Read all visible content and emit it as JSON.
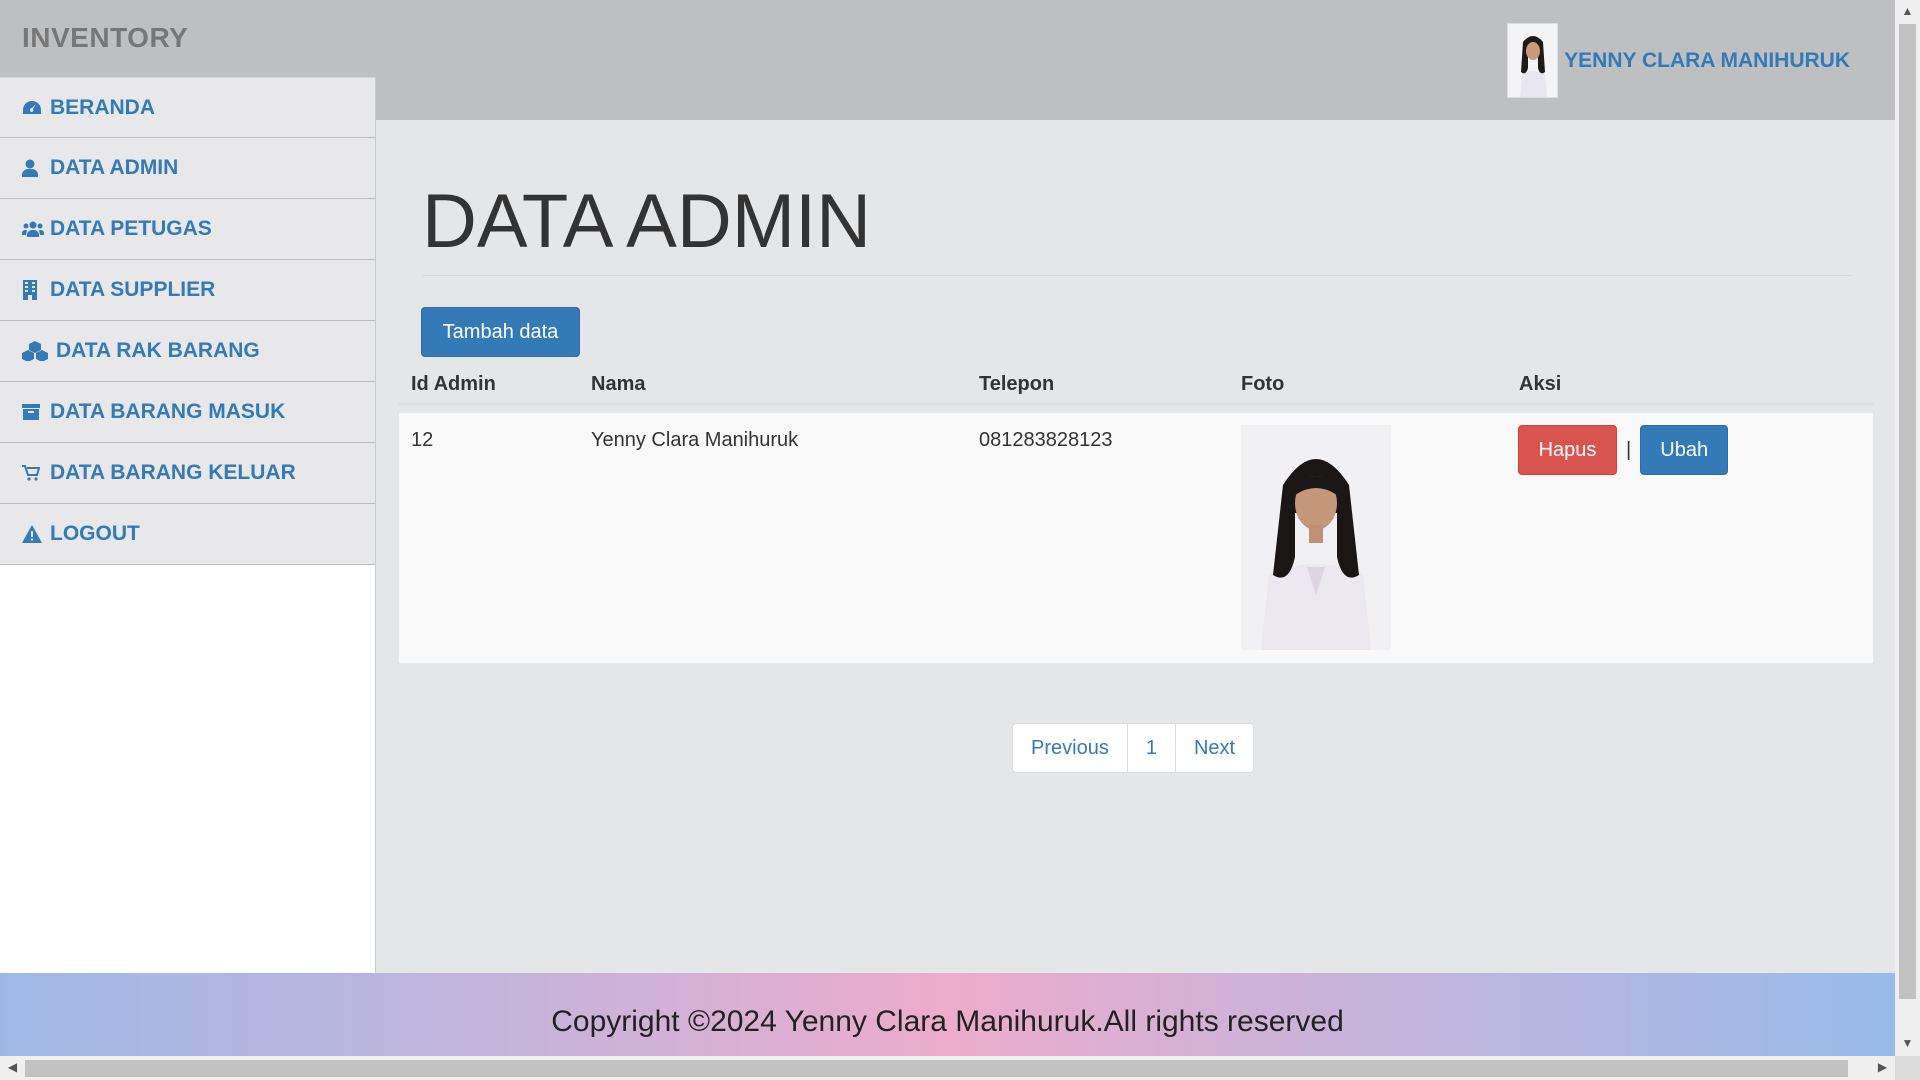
{
  "app": {
    "brand": "INVENTORY"
  },
  "user": {
    "name": "YENNY CLARA MANIHURUK"
  },
  "sidebar": {
    "items": [
      {
        "label": "BERANDA",
        "icon": "dashboard-icon"
      },
      {
        "label": "DATA ADMIN",
        "icon": "user-icon"
      },
      {
        "label": "DATA PETUGAS",
        "icon": "users-icon"
      },
      {
        "label": "DATA SUPPLIER",
        "icon": "building-icon"
      },
      {
        "label": "DATA RAK BARANG",
        "icon": "cubes-icon"
      },
      {
        "label": "DATA BARANG MASUK",
        "icon": "archive-icon"
      },
      {
        "label": "DATA BARANG KELUAR",
        "icon": "cart-icon"
      },
      {
        "label": "LOGOUT",
        "icon": "warning-icon"
      }
    ]
  },
  "main": {
    "title": "DATA ADMIN",
    "add_button": "Tambah data",
    "table": {
      "headers": [
        "Id Admin",
        "Nama",
        "Telepon",
        "Foto",
        "Aksi"
      ],
      "rows": [
        {
          "id": "12",
          "nama": "Yenny Clara Manihuruk",
          "telepon": "081283828123",
          "hapus": "Hapus",
          "separator": "|",
          "ubah": "Ubah"
        }
      ]
    },
    "pagination": {
      "previous": "Previous",
      "current": "1",
      "next": "Next"
    }
  },
  "footer": {
    "text": "Copyright ©2024 Yenny Clara Manihuruk.All rights reserved"
  },
  "colors": {
    "accent": "#337ab7",
    "danger": "#d9534f",
    "header_bg": "#bebfc1"
  }
}
